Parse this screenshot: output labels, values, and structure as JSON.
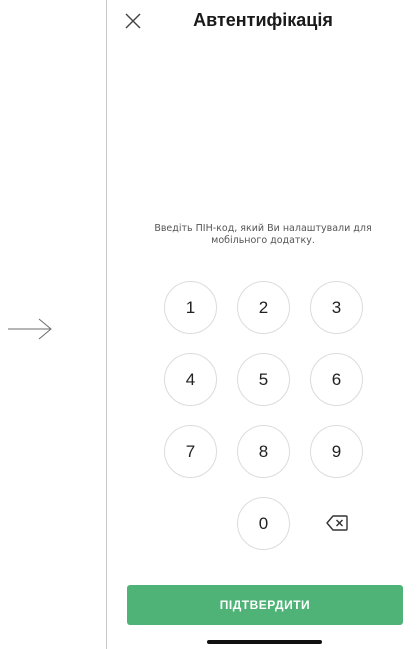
{
  "header": {
    "title": "Автентифікація",
    "close_icon": "close-icon"
  },
  "prompt": "Введіть ПІН-код, який Ви налаштували для мобільного додатку.",
  "keypad": {
    "keys": [
      "1",
      "2",
      "3",
      "4",
      "5",
      "6",
      "7",
      "8",
      "9",
      "0"
    ],
    "backspace_icon": "backspace-icon"
  },
  "confirm_button": {
    "label": "ПІДТВЕРДИТИ",
    "color": "#4fb377"
  }
}
